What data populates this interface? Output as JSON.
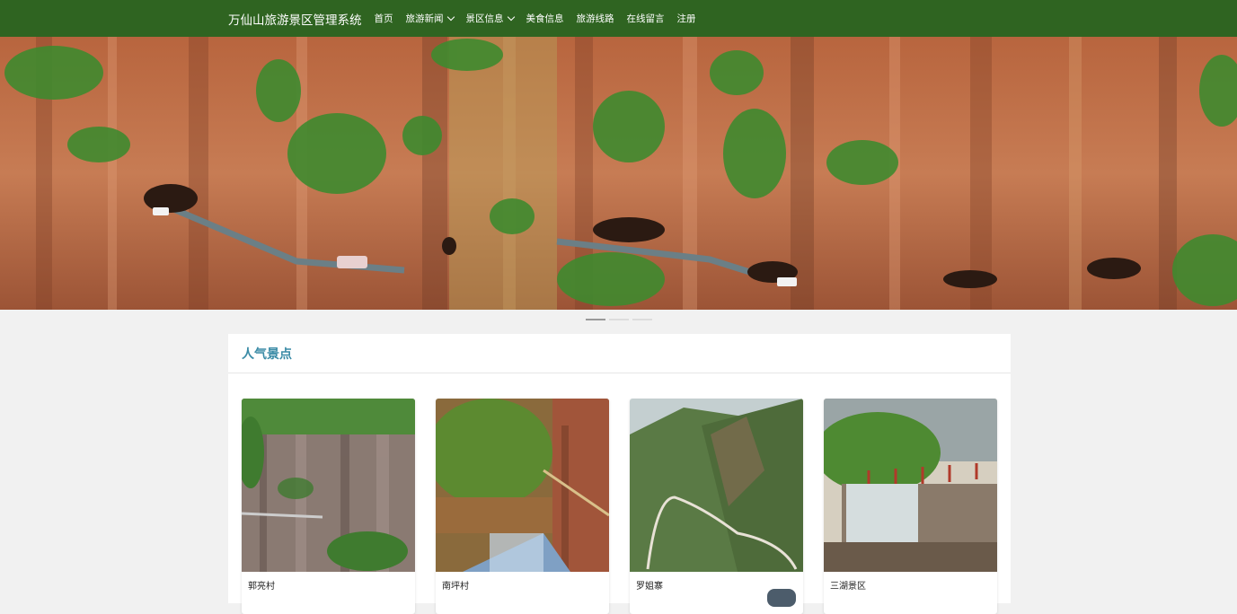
{
  "nav": {
    "brand": "万仙山旅游景区管理系统",
    "items": [
      {
        "label": "首页",
        "dropdown": false
      },
      {
        "label": "旅游新闻",
        "dropdown": true
      },
      {
        "label": "景区信息",
        "dropdown": true
      },
      {
        "label": "美食信息",
        "dropdown": false
      },
      {
        "label": "旅游线路",
        "dropdown": false
      },
      {
        "label": "在线留言",
        "dropdown": false
      },
      {
        "label": "注册",
        "dropdown": false
      }
    ]
  },
  "carousel": {
    "active_index": 0,
    "slide_count": 3
  },
  "section": {
    "title": "人气景点"
  },
  "cards": [
    {
      "name": "郭亮村"
    },
    {
      "name": "南坪村"
    },
    {
      "name": "罗姐寨"
    },
    {
      "name": "三湖景区"
    }
  ],
  "colors": {
    "navbar": "#2f6421",
    "section_title": "#3a8ba6",
    "background": "#f1f1f1"
  }
}
